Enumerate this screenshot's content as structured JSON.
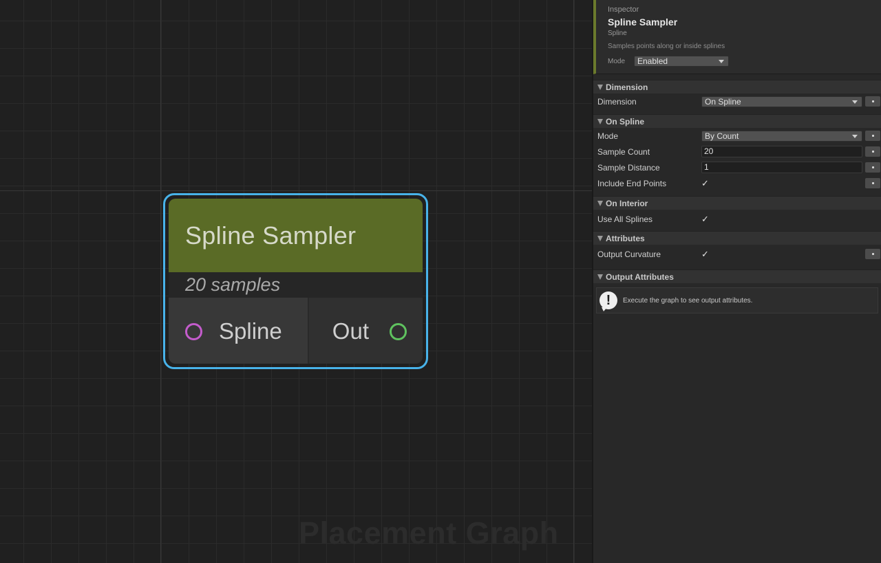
{
  "graph": {
    "watermark": "Placement Graph",
    "node": {
      "title": "Spline Sampler",
      "subtitle": "20 samples",
      "input_port": "Spline",
      "output_port": "Out",
      "colors": {
        "header": "#5a6b26",
        "selection": "#48b3ea",
        "input_port": "#c45ccc",
        "output_port": "#5fc25f"
      }
    }
  },
  "inspector": {
    "caption": "Inspector",
    "title": "Spline Sampler",
    "category": "Spline",
    "description": "Samples points along or inside splines",
    "mode_label": "Mode",
    "mode_value": "Enabled",
    "sections": {
      "dimension": {
        "header": "Dimension",
        "dimension_label": "Dimension",
        "dimension_value": "On Spline"
      },
      "on_spline": {
        "header": "On Spline",
        "mode_label": "Mode",
        "mode_value": "By Count",
        "sample_count_label": "Sample Count",
        "sample_count_value": "20",
        "sample_distance_label": "Sample Distance",
        "sample_distance_value": "1",
        "include_end_points_label": "Include End Points",
        "include_end_points_checked": true
      },
      "on_interior": {
        "header": "On Interior",
        "use_all_splines_label": "Use All Splines",
        "use_all_splines_checked": true
      },
      "attributes": {
        "header": "Attributes",
        "output_curvature_label": "Output Curvature",
        "output_curvature_checked": true
      },
      "output_attributes": {
        "header": "Output Attributes",
        "hint_icon": "exclamation-icon",
        "hint": "Execute the graph to see output attributes."
      }
    }
  }
}
